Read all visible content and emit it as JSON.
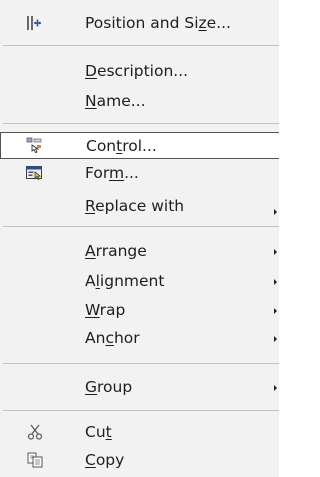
{
  "menu": {
    "items": [
      {
        "pre": "Position and Si",
        "mn": "z",
        "post": "e...",
        "icon": "position-size-icon",
        "submenu": false
      },
      {
        "pre": "",
        "mn": "D",
        "post": "escription...",
        "icon": null,
        "submenu": false
      },
      {
        "pre": "",
        "mn": "N",
        "post": "ame...",
        "icon": null,
        "submenu": false
      },
      {
        "pre": "Con",
        "mn": "t",
        "post": "rol...",
        "icon": "control-icon",
        "submenu": false
      },
      {
        "pre": "For",
        "mn": "m",
        "post": "...",
        "icon": "form-icon",
        "submenu": false
      },
      {
        "pre": "",
        "mn": "R",
        "post": "eplace with",
        "icon": null,
        "submenu": true
      },
      {
        "pre": "",
        "mn": "A",
        "post": "rrange",
        "icon": null,
        "submenu": true
      },
      {
        "pre": "A",
        "mn": "l",
        "post": "ignment",
        "icon": null,
        "submenu": true
      },
      {
        "pre": "",
        "mn": "W",
        "post": "rap",
        "icon": null,
        "submenu": true
      },
      {
        "pre": "An",
        "mn": "c",
        "post": "hor",
        "icon": null,
        "submenu": true
      },
      {
        "pre": "",
        "mn": "G",
        "post": "roup",
        "icon": null,
        "submenu": true
      },
      {
        "pre": "Cu",
        "mn": "t",
        "post": "",
        "icon": "scissors-icon",
        "submenu": false
      },
      {
        "pre": "",
        "mn": "C",
        "post": "opy",
        "icon": "copy-icon",
        "submenu": false
      }
    ],
    "highlighted_index": 3
  }
}
